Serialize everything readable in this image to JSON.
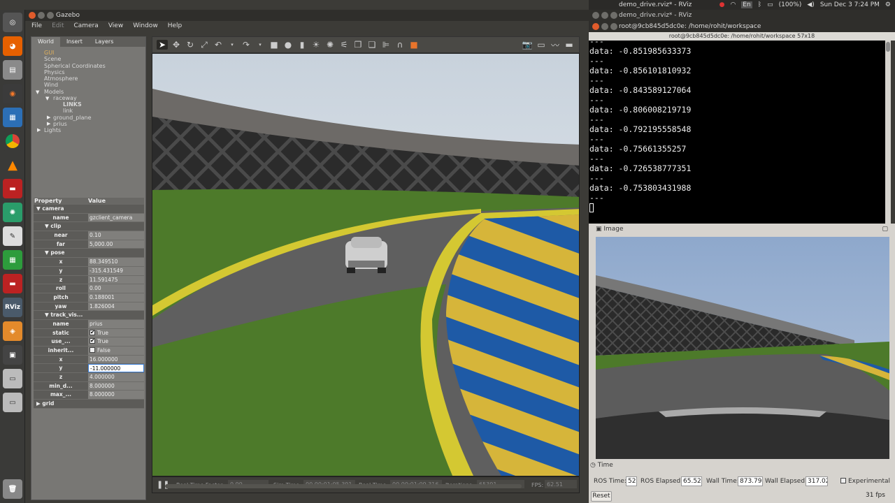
{
  "topbar": {
    "window_title": "demo_drive.rviz* - RViz",
    "battery": "(100%)",
    "clock": "Sun Dec 3  7:24 PM",
    "keyboard": "En"
  },
  "launcher": {
    "items": [
      "ubuntu-icon",
      "firefox-icon",
      "files-icon",
      "blender-icon",
      "vm-icon",
      "chrome-icon",
      "vlc-icon",
      "app-icon",
      "atom-icon",
      "editor-icon",
      "spreadsheet-icon",
      "app2-icon",
      "rviz-icon",
      "gazebo-icon",
      "workspace-icon",
      "drive-icon",
      "drive2-icon",
      "trash-icon"
    ],
    "rviz_label": "RViz"
  },
  "gazebo": {
    "title": "Gazebo",
    "menu": [
      "File",
      "Edit",
      "Camera",
      "View",
      "Window",
      "Help"
    ],
    "tabs": [
      "World",
      "Insert",
      "Layers"
    ],
    "tree": {
      "gui": "GUI",
      "scene": "Scene",
      "spherical": "Spherical Coordinates",
      "physics": "Physics",
      "atmosphere": "Atmosphere",
      "wind": "Wind",
      "models": "Models",
      "raceway": "raceway",
      "links": "LINKS",
      "link": "link",
      "ground_plane": "ground_plane",
      "prius": "prius",
      "lights": "Lights"
    },
    "props_header": {
      "property": "Property",
      "value": "Value"
    },
    "props": {
      "camera": "camera",
      "name_k": "name",
      "name_v": "gzclient_camera",
      "clip": "clip",
      "near_k": "near",
      "near_v": "0.10",
      "far_k": "far",
      "far_v": "5,000.00",
      "pose": "pose",
      "x_k": "x",
      "x_v": "88.349510",
      "y_k": "y",
      "y_v": "-315.431549",
      "z_k": "z",
      "z_v": "11.591475",
      "roll_k": "roll",
      "roll_v": "0.00",
      "pitch_k": "pitch",
      "pitch_v": "0.188001",
      "yaw_k": "yaw",
      "yaw_v": "1.826004",
      "track": "track_vis...",
      "tname_k": "name",
      "tname_v": "prius",
      "static_k": "static",
      "static_v": "True",
      "use_k": "use_...",
      "use_v": "True",
      "inherit_k": "inherit...",
      "inherit_v": "False",
      "tx_k": "x",
      "tx_v": "16.000000",
      "ty_k": "y",
      "ty_v": "-11.000000",
      "tz_k": "z",
      "tz_v": "4.000000",
      "mind_k": "min_d...",
      "mind_v": "8.000000",
      "maxd_k": "max_...",
      "maxd_v": "8.000000",
      "grid": "grid"
    },
    "status": {
      "rtf_label": "Real Time Factor:",
      "rtf": "0.99",
      "sim_label": "Sim Time:",
      "sim": "00 00:01:05.391",
      "real_label": "Real Time:",
      "real": "00 00:01:09.316",
      "iter_label": "Iterations:",
      "iter": "65391",
      "fps_label": "FPS:",
      "fps": "62.51"
    }
  },
  "terminal": {
    "window_title": "root@9cb845d5dc0e: /home/rohit/workspace",
    "header": "root@9cb845d5dc0e: /home/rohit/workspace 57x18",
    "lines": [
      "---",
      "data: -0.851985633373",
      "---",
      "data: -0.856101810932",
      "---",
      "data: -0.843589127064",
      "---",
      "data: -0.806008219719",
      "---",
      "data: -0.792195558548",
      "---",
      "data: -0.75661355257",
      "---",
      "data: -0.726538777351",
      "---",
      "data: -0.753803431988",
      "---"
    ]
  },
  "rviz": {
    "image_title": "Image",
    "time_title": "Time",
    "ros_time_label": "ROS Time:",
    "ros_time": "52",
    "ros_elapsed_label": "ROS Elapsed:",
    "ros_elapsed": "65.52",
    "wall_time_label": "Wall Time:",
    "wall_time": "873.79",
    "wall_elapsed_label": "Wall Elapsed:",
    "wall_elapsed": "317.02",
    "experimental": "Experimental",
    "reset": "Reset",
    "fps": "31 fps"
  }
}
